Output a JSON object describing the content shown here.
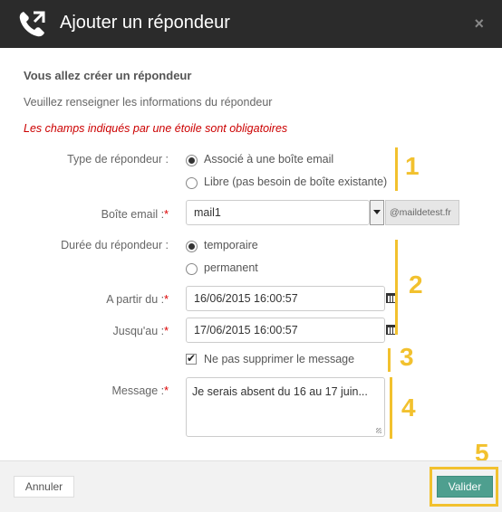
{
  "dialog": {
    "title": "Ajouter un répondeur",
    "close_symbol": "×",
    "icon": "phone-forward-icon"
  },
  "intro": {
    "heading": "Vous allez créer un répondeur",
    "subtext": "Veuillez renseigner les informations du répondeur",
    "required_note": "Les champs indiqués par une étoile sont obligatoires"
  },
  "form": {
    "type_label": "Type de répondeur :",
    "type_options": [
      "Associé à une boîte email",
      "Libre (pas besoin de boîte existante)"
    ],
    "type_selected": 0,
    "mailbox_label": "Boîte email :",
    "mailbox_value": "mail1",
    "mailbox_domain": "@maildetest.fr",
    "duration_label": "Durée du répondeur :",
    "duration_options": [
      "temporaire",
      "permanent"
    ],
    "duration_selected": 0,
    "from_label": "A partir du :",
    "from_value": "16/06/2015 16:00:57",
    "until_label": "Jusqu'au :",
    "until_value": "17/06/2015 16:00:57",
    "keep_message_label": "Ne pas supprimer le message",
    "keep_message_checked": true,
    "message_label": "Message :",
    "message_value": "Je serais absent du 16 au 17 juin..."
  },
  "annotations": [
    "1",
    "2",
    "3",
    "4",
    "5"
  ],
  "footer": {
    "cancel_label": "Annuler",
    "submit_label": "Valider"
  },
  "colors": {
    "titlebar": "#2b2b2b",
    "required": "#cc0000",
    "accent": "#4e9f8f",
    "annotation": "#f2c12e"
  }
}
